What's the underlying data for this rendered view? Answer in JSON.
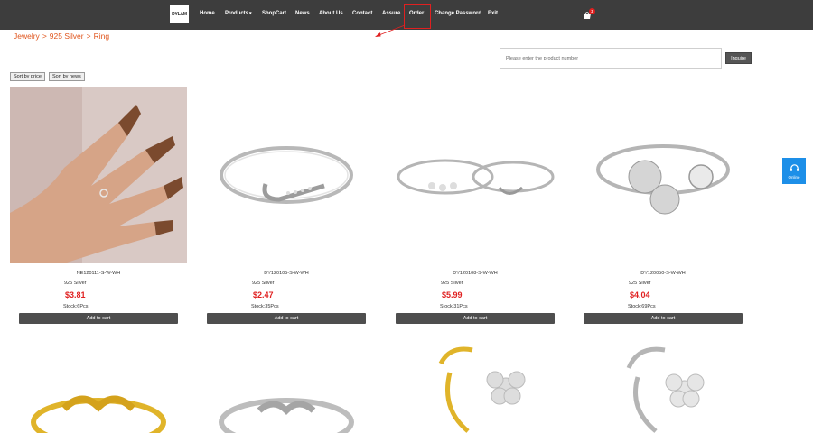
{
  "nav": {
    "logo_text": "DYLAM",
    "items": [
      {
        "label": "Home"
      },
      {
        "label": "Products"
      },
      {
        "label": "ShopCart"
      },
      {
        "label": "News"
      },
      {
        "label": "About Us"
      },
      {
        "label": "Contact"
      },
      {
        "label": "Assure"
      },
      {
        "label": "Order"
      },
      {
        "label": "Change Password"
      },
      {
        "label": "Exit"
      }
    ],
    "cart_count": "3"
  },
  "breadcrumb": [
    "Jewelry",
    ">",
    "925 Silver",
    ">",
    "Ring"
  ],
  "search": {
    "placeholder": "Please enter the product number",
    "button_label": "Inquire"
  },
  "sort": {
    "by_price": "Sort by price",
    "by_news": "Sort by news"
  },
  "products": [
    {
      "code": "NE120111-S-W-WH",
      "material": "925 Silver",
      "price": "$3.81",
      "stock": "Stock:6Pcs",
      "button": "Add to cart"
    },
    {
      "code": "DY120105-S-W-WH",
      "material": "925 Silver",
      "price": "$2.47",
      "stock": "Stock:35Pcs",
      "button": "Add to cart"
    },
    {
      "code": "DY120108-S-W-WH",
      "material": "925 Silver",
      "price": "$5.99",
      "stock": "Stock:31Pcs",
      "button": "Add to cart"
    },
    {
      "code": "DY120050-S-W-WH",
      "material": "925 Silver",
      "price": "$4.04",
      "stock": "Stock:69Pcs",
      "button": "Add to cart"
    }
  ],
  "online": {
    "label": "Online"
  },
  "colors": {
    "nav_bg": "#3d3d3d",
    "accent": "#e0561e",
    "price": "#e02020",
    "button_bg": "#4e4e4e",
    "online_bg": "#1d8fe8"
  }
}
